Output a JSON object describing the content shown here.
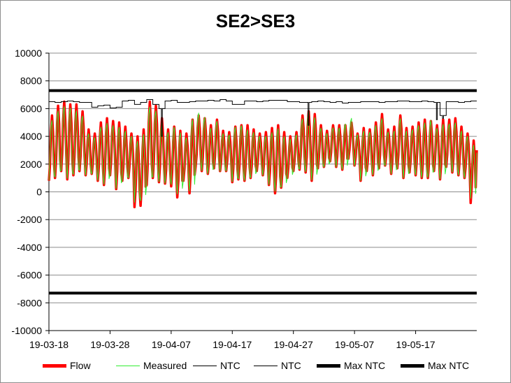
{
  "chart_data": {
    "type": "line",
    "title": "SE2>SE3",
    "xlabel": "",
    "ylabel": "",
    "ylim": [
      -10000,
      10000
    ],
    "y_ticks": [
      10000,
      8000,
      6000,
      4000,
      2000,
      0,
      -2000,
      -4000,
      -6000,
      -8000,
      -10000
    ],
    "y_tick_labels": [
      "10000",
      "8000",
      "6000",
      "4000",
      "2000",
      "0",
      "-2000",
      "-4000",
      "-6000",
      "-8000",
      "-10000"
    ],
    "x_tick_labels": [
      "19-03-18",
      "19-03-28",
      "19-04-07",
      "19-04-17",
      "19-04-27",
      "19-05-07",
      "19-05-17"
    ],
    "x_range_days": [
      "2019-03-18",
      "2019-05-27"
    ],
    "grid": "horizontal",
    "legend_placement": "bottom",
    "series": [
      {
        "name": "Flow",
        "color": "#ff0000",
        "daily_range": [
          [
            800,
            5500
          ],
          [
            1000,
            6200
          ],
          [
            1500,
            6500
          ],
          [
            900,
            6300
          ],
          [
            1200,
            6300
          ],
          [
            1500,
            5800
          ],
          [
            1200,
            4500
          ],
          [
            1300,
            4200
          ],
          [
            800,
            5000
          ],
          [
            500,
            5300
          ],
          [
            1200,
            5100
          ],
          [
            200,
            5000
          ],
          [
            800,
            4700
          ],
          [
            1000,
            4200
          ],
          [
            -1100,
            4000
          ],
          [
            -1000,
            4500
          ],
          [
            500,
            6500
          ],
          [
            1000,
            6200
          ],
          [
            700,
            5300
          ],
          [
            600,
            4500
          ],
          [
            400,
            4700
          ],
          [
            -400,
            4400
          ],
          [
            800,
            4200
          ],
          [
            -100,
            5200
          ],
          [
            1800,
            5500
          ],
          [
            1500,
            5300
          ],
          [
            1300,
            4800
          ],
          [
            1700,
            5200
          ],
          [
            1500,
            4400
          ],
          [
            1500,
            4300
          ],
          [
            700,
            4700
          ],
          [
            900,
            4800
          ],
          [
            800,
            4800
          ],
          [
            1000,
            4500
          ],
          [
            1500,
            4200
          ],
          [
            1200,
            4300
          ],
          [
            500,
            4600
          ],
          [
            -100,
            4800
          ],
          [
            300,
            4300
          ],
          [
            1000,
            4000
          ],
          [
            1500,
            4300
          ],
          [
            1600,
            5500
          ],
          [
            1400,
            5800
          ],
          [
            800,
            5600
          ],
          [
            1700,
            4800
          ],
          [
            1800,
            4400
          ],
          [
            2200,
            4800
          ],
          [
            1800,
            4800
          ],
          [
            1600,
            4800
          ],
          [
            2400,
            5000
          ],
          [
            1900,
            4200
          ],
          [
            800,
            4600
          ],
          [
            1500,
            4500
          ],
          [
            1200,
            5000
          ],
          [
            1700,
            5600
          ],
          [
            1900,
            4500
          ],
          [
            1300,
            4700
          ],
          [
            1700,
            5500
          ],
          [
            1000,
            4600
          ],
          [
            1400,
            4700
          ],
          [
            1200,
            5000
          ],
          [
            1000,
            5200
          ],
          [
            1000,
            5100
          ],
          [
            1500,
            4800
          ],
          [
            900,
            5200
          ],
          [
            1800,
            5200
          ],
          [
            1400,
            5300
          ],
          [
            1200,
            4700
          ],
          [
            1000,
            4200
          ],
          [
            -800,
            3700
          ],
          [
            3000,
            3700
          ]
        ]
      },
      {
        "name": "Measured",
        "color": "#33ee33",
        "daily_range": [
          [
            700,
            5300
          ],
          [
            900,
            6000
          ],
          [
            1400,
            6300
          ],
          [
            800,
            6200
          ],
          [
            1100,
            6000
          ],
          [
            1400,
            5600
          ],
          [
            1100,
            4300
          ],
          [
            1200,
            4000
          ],
          [
            700,
            4800
          ],
          [
            400,
            5100
          ],
          [
            1100,
            4900
          ],
          [
            100,
            4800
          ],
          [
            700,
            4500
          ],
          [
            900,
            4100
          ],
          [
            -900,
            3800
          ],
          [
            -800,
            4300
          ],
          [
            400,
            6300
          ],
          [
            900,
            6000
          ],
          [
            600,
            5100
          ],
          [
            500,
            4400
          ],
          [
            400,
            4800
          ],
          [
            -300,
            4400
          ],
          [
            700,
            4000
          ],
          [
            -100,
            5400
          ],
          [
            1700,
            5800
          ],
          [
            1400,
            5500
          ],
          [
            1200,
            4700
          ],
          [
            1600,
            5200
          ],
          [
            1400,
            4300
          ],
          [
            1400,
            4200
          ],
          [
            600,
            4800
          ],
          [
            800,
            4900
          ],
          [
            700,
            4600
          ],
          [
            900,
            4400
          ],
          [
            1400,
            4100
          ],
          [
            1100,
            4100
          ],
          [
            400,
            4400
          ],
          [
            -100,
            4700
          ],
          [
            200,
            4100
          ],
          [
            900,
            3900
          ],
          [
            1400,
            4200
          ],
          [
            1500,
            5400
          ],
          [
            1300,
            5900
          ],
          [
            700,
            5500
          ],
          [
            1600,
            4700
          ],
          [
            1700,
            4300
          ],
          [
            2100,
            4700
          ],
          [
            1700,
            4700
          ],
          [
            1500,
            5000
          ],
          [
            2300,
            5400
          ],
          [
            1800,
            4200
          ],
          [
            700,
            4500
          ],
          [
            1400,
            4400
          ],
          [
            1100,
            4900
          ],
          [
            1600,
            5400
          ],
          [
            1800,
            4400
          ],
          [
            1200,
            4500
          ],
          [
            1600,
            5400
          ],
          [
            900,
            4500
          ],
          [
            1300,
            4600
          ],
          [
            1100,
            4900
          ],
          [
            900,
            5100
          ],
          [
            900,
            5300
          ],
          [
            1400,
            4700
          ],
          [
            800,
            5000
          ],
          [
            1700,
            5000
          ],
          [
            1300,
            5100
          ],
          [
            1100,
            4500
          ],
          [
            900,
            4100
          ],
          [
            -600,
            3500
          ],
          [
            2800,
            3500
          ]
        ]
      },
      {
        "name": "NTC",
        "color": "#000000",
        "values_by_day": [
          6500,
          6450,
          6500,
          6550,
          6500,
          6450,
          6450,
          6100,
          6200,
          6250,
          6050,
          6100,
          6550,
          6600,
          6300,
          6450,
          6650,
          6300,
          6000,
          6550,
          6600,
          6450,
          6450,
          6500,
          6550,
          6550,
          6600,
          6550,
          6650,
          6550,
          6300,
          6300,
          6550,
          6550,
          6500,
          6550,
          6600,
          6600,
          6600,
          6500,
          6500,
          6450,
          6450,
          6500,
          6550,
          6500,
          6450,
          6500,
          6400,
          6450,
          6450,
          6500,
          6500,
          6500,
          6450,
          6500,
          6500,
          6550,
          6550,
          6500,
          6500,
          6550,
          6500,
          6450,
          5500,
          6500,
          6500,
          6450,
          6500,
          6550,
          6550
        ],
        "dips": [
          [
            "2019-04-05",
            4000
          ],
          [
            "2019-04-29",
            4800
          ],
          [
            "2019-05-20",
            5200
          ],
          [
            "2019-05-21",
            5300
          ]
        ]
      },
      {
        "name": "NTC",
        "color": "#000000",
        "values_by_day": []
      },
      {
        "name": "Max NTC",
        "color": "#000000",
        "values": [
          7300
        ]
      },
      {
        "name": "Max NTC",
        "color": "#000000",
        "values": [
          -7300
        ]
      }
    ]
  }
}
